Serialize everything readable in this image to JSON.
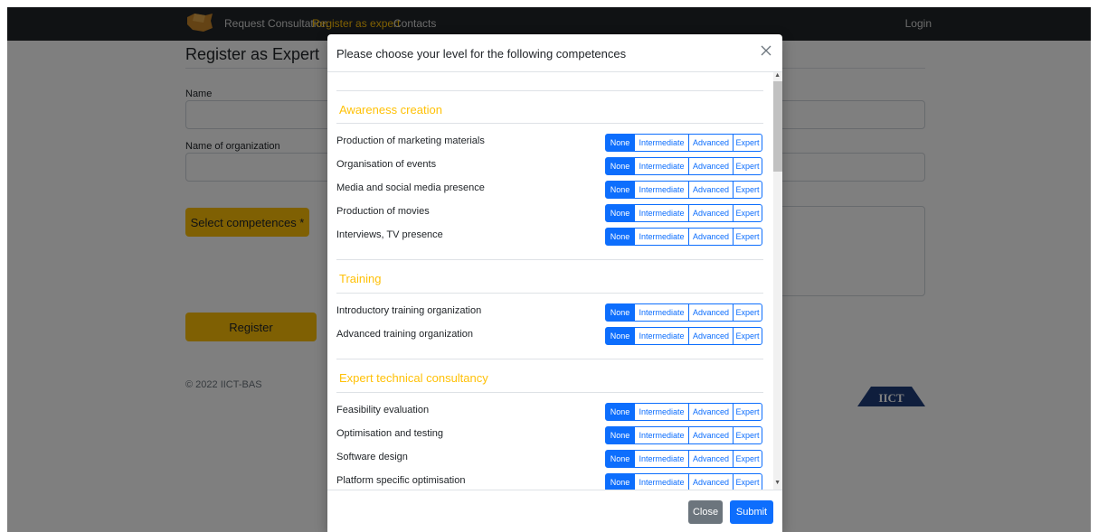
{
  "nav": {
    "links": [
      "Request Consultation",
      "Register as expert",
      "Contacts"
    ],
    "login": "Login"
  },
  "page": {
    "title": "Register as Expert",
    "name_label": "Name",
    "org_label": "Name of organization",
    "select_btn": "Select competences *",
    "register_btn": "Register",
    "footer": "© 2022 IICT-BAS",
    "logo_text": "IICT"
  },
  "modal": {
    "title": "Please choose your level for the following competences",
    "levels": [
      "None",
      "Intermediate",
      "Advanced",
      "Expert"
    ],
    "selected_level": "None",
    "sections": [
      {
        "title": "Awareness creation",
        "items": [
          "Production of marketing materials",
          "Organisation of events",
          "Media and social media presence",
          "Production of movies",
          "Interviews, TV presence"
        ]
      },
      {
        "title": "Training",
        "items": [
          "Introductory training organization",
          "Advanced training organization"
        ]
      },
      {
        "title": "Expert technical consultancy",
        "items": [
          "Feasibility evaluation",
          "Optimisation and testing",
          "Software design",
          "Platform specific optimisation"
        ]
      }
    ],
    "close_btn": "Close",
    "submit_btn": "Submit"
  },
  "colors": {
    "accent": "#ffc107",
    "primary": "#0d6efd",
    "secondary": "#6c757d",
    "navbar": "#212529"
  }
}
